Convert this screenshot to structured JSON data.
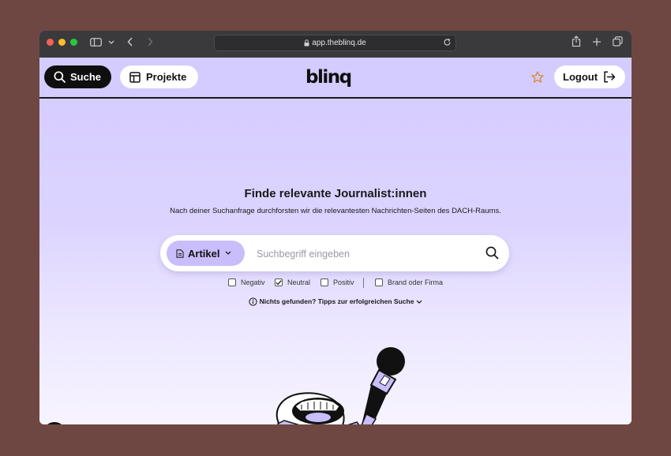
{
  "browser": {
    "url": "app.theblinq.de"
  },
  "header": {
    "search_label": "Suche",
    "projects_label": "Projekte",
    "logo_text": "blinq",
    "logout_label": "Logout"
  },
  "hero": {
    "title": "Finde relevante Journalist:innen",
    "subtitle": "Nach deiner Suchanfrage durchforsten wir die relevantesten Nachrichten-Seiten des DACH-Raums."
  },
  "search": {
    "type_label": "Artikel",
    "placeholder": "Suchbegriff eingeben",
    "value": ""
  },
  "filters": [
    {
      "label": "Negativ",
      "checked": false
    },
    {
      "label": "Neutral",
      "checked": true
    },
    {
      "label": "Positiv",
      "checked": false
    },
    {
      "label": "Brand oder Firma",
      "checked": false
    }
  ],
  "tips_label": "Nichts gefunden? Tipps zur erfolgreichen Suche",
  "colors": {
    "background": "#d4cbff",
    "accent": "#c9bdfb",
    "dark": "#0f0f0f",
    "star": "#d98a2b"
  }
}
